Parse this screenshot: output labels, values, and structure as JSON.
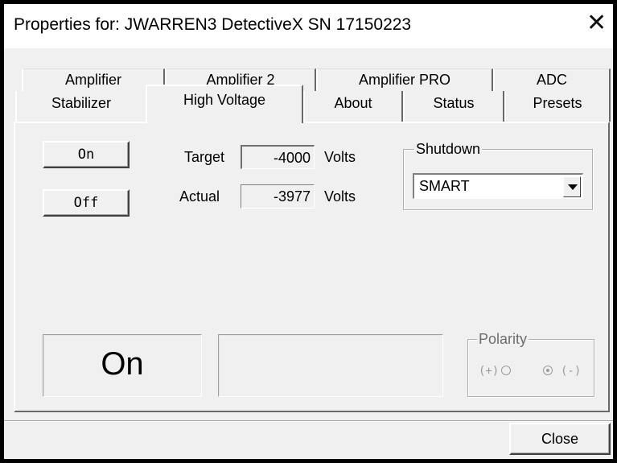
{
  "window": {
    "title": "Properties for: JWARREN3 DetectiveX SN 17150223",
    "close_glyph": "✕"
  },
  "tabs": {
    "back_row": [
      "Amplifier",
      "Amplifier 2",
      "Amplifier PRO",
      "ADC"
    ],
    "front_row": [
      "Stabilizer",
      "High Voltage",
      "About",
      "Status",
      "Presets"
    ],
    "selected": "High Voltage"
  },
  "high_voltage": {
    "on_button": "On",
    "off_button": "Off",
    "target_label": "Target",
    "target_value": "-4000",
    "target_unit": "Volts",
    "actual_label": "Actual",
    "actual_value": "-3977",
    "actual_unit": "Volts",
    "shutdown": {
      "legend": "Shutdown",
      "selected": "SMART"
    },
    "state_text": "On",
    "message_text": "",
    "polarity": {
      "legend": "Polarity",
      "positive_label": "(+)",
      "negative_label": "(-)",
      "selected": "negative"
    }
  },
  "footer": {
    "close_button": "Close"
  }
}
